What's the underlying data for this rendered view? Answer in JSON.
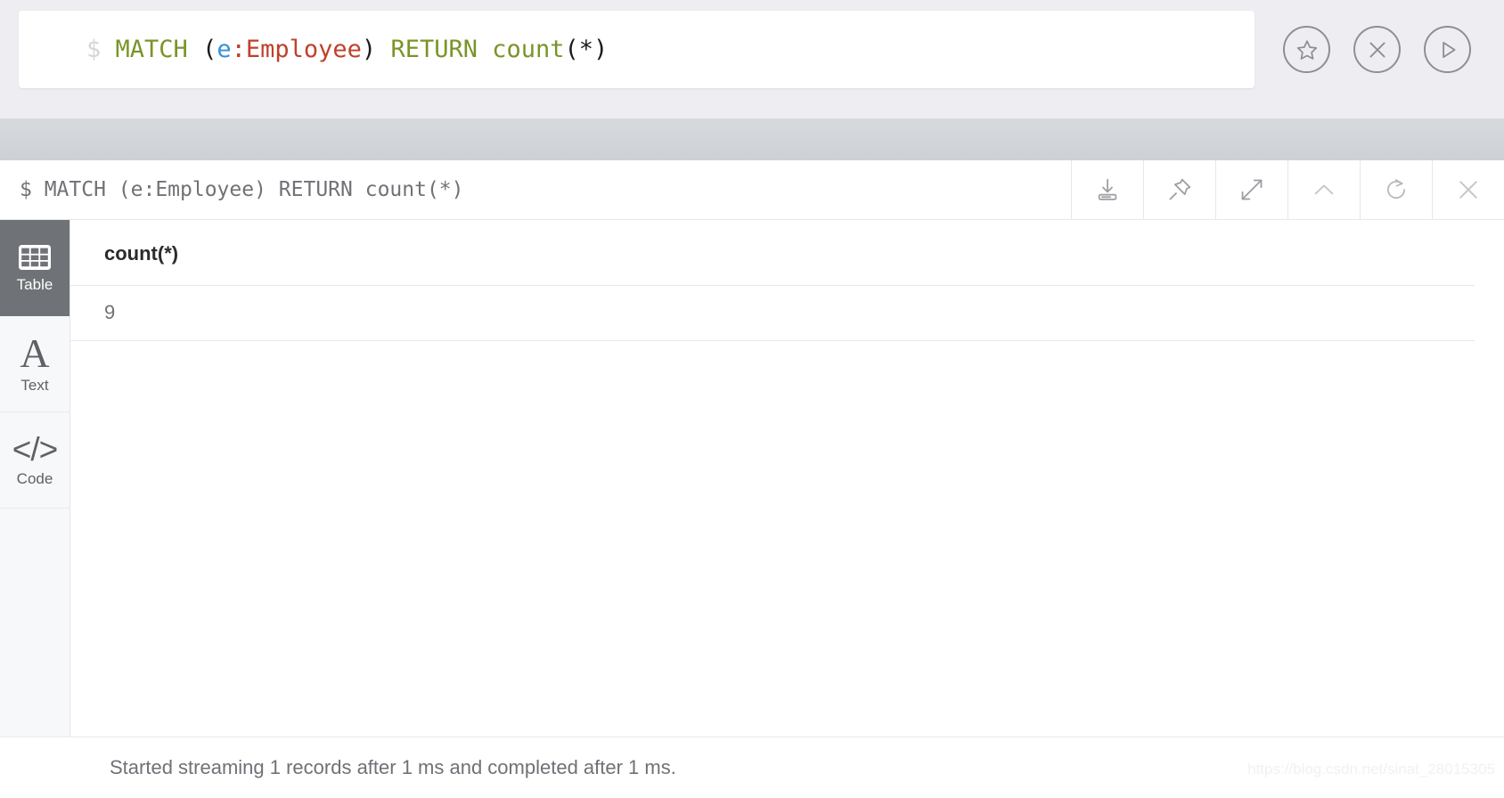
{
  "editor": {
    "prompt": "$",
    "tokens": [
      {
        "text": "MATCH",
        "type": "kw"
      },
      {
        "text": " ",
        "type": "sp"
      },
      {
        "text": "(",
        "type": "paren"
      },
      {
        "text": "e",
        "type": "var"
      },
      {
        "text": ":Employee",
        "type": "label"
      },
      {
        "text": ")",
        "type": "paren"
      },
      {
        "text": " ",
        "type": "sp"
      },
      {
        "text": "RETURN",
        "type": "kw"
      },
      {
        "text": " ",
        "type": "sp"
      },
      {
        "text": "count",
        "type": "kw"
      },
      {
        "text": "(*)",
        "type": "plain"
      }
    ],
    "query_text": "MATCH (e:Employee) RETURN count(*)",
    "buttons": [
      {
        "name": "favorite-button",
        "icon": "star-icon",
        "label": "Favorite"
      },
      {
        "name": "clear-button",
        "icon": "close-circle-icon",
        "label": "Clear"
      },
      {
        "name": "run-button",
        "icon": "play-icon",
        "label": "Run"
      }
    ]
  },
  "frame": {
    "query_display": "$ MATCH (e:Employee) RETURN count(*)",
    "actions": [
      {
        "name": "download-button",
        "icon": "download-icon",
        "label": "Download"
      },
      {
        "name": "pin-button",
        "icon": "pin-icon",
        "label": "Pin"
      },
      {
        "name": "expand-button",
        "icon": "expand-icon",
        "label": "Fullscreen"
      },
      {
        "name": "collapse-button",
        "icon": "chevron-up-icon",
        "label": "Collapse"
      },
      {
        "name": "rerun-button",
        "icon": "refresh-icon",
        "label": "Rerun"
      },
      {
        "name": "close-button",
        "icon": "close-icon",
        "label": "Close"
      }
    ]
  },
  "view_tabs": [
    {
      "label": "Table",
      "icon": "table-grid-icon",
      "active": true
    },
    {
      "label": "Text",
      "icon": "letter-a-icon",
      "active": false
    },
    {
      "label": "Code",
      "icon": "code-brackets-icon",
      "active": false
    }
  ],
  "result": {
    "columns": [
      "count(*)"
    ],
    "rows": [
      [
        "9"
      ]
    ]
  },
  "status": {
    "message": "Started streaming 1 records after 1 ms and completed after 1 ms."
  },
  "watermark": {
    "text": "https://blog.csdn.net/sinat_28015305"
  },
  "colors": {
    "keyword": "#7a9428",
    "variable": "#3a8fd8",
    "label": "#c0402a",
    "active_tab_bg": "#6f7276",
    "editor_bg": "#eeeef2",
    "band_gray": "#d2d5d9"
  }
}
